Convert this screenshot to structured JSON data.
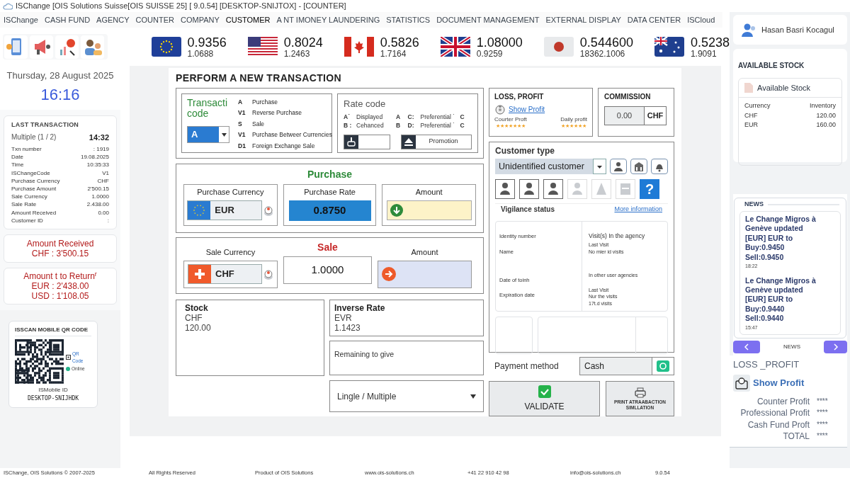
{
  "window": {
    "title": "ISChange [OIS Solutions Suisse[OIS SUISSE 25] [ 9.0.54] [DESKTOP-SNIJTOX] - [COUNTER]"
  },
  "menu": [
    {
      "label": "ISChange",
      "selected": false
    },
    {
      "label": "CASH FUND",
      "selected": false
    },
    {
      "label": "AGENCY",
      "selected": false
    },
    {
      "label": "COUNTER",
      "selected": false
    },
    {
      "label": "COMPANY",
      "selected": false
    },
    {
      "label": "CUSTOMER",
      "selected": true
    },
    {
      "label": "A NT IMONEY LAUNDERING",
      "selected": false
    },
    {
      "label": "STATISTICS",
      "selected": false
    },
    {
      "label": "DOCUMENT MANAGEMENT",
      "selected": false
    },
    {
      "label": "EXTERNAL DISPLAY",
      "selected": false
    },
    {
      "label": "DATA CENTER",
      "selected": false
    },
    {
      "label": "ISCloud",
      "selected": false
    }
  ],
  "rates": [
    {
      "kind": "eu",
      "rate": "0.9356",
      "inverse": "1.0688"
    },
    {
      "kind": "us",
      "rate": "0.8024",
      "inverse": "1.2463"
    },
    {
      "kind": "ca",
      "rate": "0.5826",
      "inverse": "1.7164"
    },
    {
      "kind": "gb",
      "rate": "1.08000",
      "inverse": "0.9259"
    },
    {
      "kind": "jp",
      "rate": "0.544600",
      "inverse": "18362.1006"
    },
    {
      "kind": "au",
      "rate": "0.5238",
      "inverse": "1.9091"
    }
  ],
  "clock": {
    "date": "Thursday, 28 August 2025",
    "time": "16:16"
  },
  "last_transaction": {
    "title": "LAST TRANSACTION",
    "mode": "Multiple (1 / 2)",
    "time": "14:32",
    "fields": [
      {
        "label": "Txn number",
        "value": ": 1919"
      },
      {
        "label": "Date",
        "value": "19.08.2025"
      },
      {
        "label": "Time",
        "value": "10:35:33"
      },
      {
        "label": "ISChangeCode",
        "value": "V1"
      },
      {
        "label": "Purchase Currency",
        "value": "CHF"
      },
      {
        "label": "Purchase Amount",
        "value": "2'500.15"
      },
      {
        "label": "Sale Currency",
        "value": "1.0000"
      },
      {
        "label": "Sale Rate",
        "value": "2.438.00"
      },
      {
        "label": "Amount Received",
        "value": "0.00"
      },
      {
        "label": "Customer ID",
        "value": ":"
      }
    ]
  },
  "amount_received": [
    "Amount Received",
    "CHF : 3'500.15"
  ],
  "amount_to_return": [
    "Amount t to Return$^{r}$",
    "EUR : 2'438.00",
    "USD : 1'108.05"
  ],
  "qr": {
    "title": "ISSCAN MOBILE QR CODE",
    "link": "QR Code",
    "status": "Online",
    "id_label": "ISMobile ID",
    "id": "DESKTOP-SNIJHDK"
  },
  "transaction": {
    "title": "PERFORM A NEW TRANSACTION",
    "code_label": "Transacti\ncode",
    "code_value": "A",
    "codes": [
      {
        "code": "A",
        "label": "Purchase"
      },
      {
        "code": "V1",
        "label": "Reverse Purchase"
      },
      {
        "code": "S",
        "label": "Sale"
      },
      {
        "code": "V1",
        "label": "Purchase Betweer Currencies"
      },
      {
        "code": "D1",
        "label": "Foreign Exchange Sale"
      }
    ],
    "rate_code": {
      "title": "Rate code",
      "items": [
        {
          "key": "A˙",
          "label": "Displayed",
          "code": "A"
        },
        {
          "key": "C:",
          "label": "Preferential ˙",
          "code": "C"
        },
        {
          "key": "B :",
          "label": "Cehanced",
          "code": "B"
        },
        {
          "key": "D:",
          "label": "Preferential ˙",
          "code": "C"
        }
      ],
      "promotion": "Promotion"
    }
  },
  "purchase": {
    "title": "Purchase",
    "currency_label": "Purchase Currency",
    "currency": "EUR",
    "rate_label": "Purchase Rate",
    "rate": "0.8750",
    "amount_label": "Amount"
  },
  "sale": {
    "title": "Sale",
    "currency_label": "Sale Currency",
    "currency": "CHF",
    "rate": "1.0000",
    "amount_label": "Amount"
  },
  "stock": {
    "title": "Stock",
    "currency": "CHF",
    "amount": "120.00"
  },
  "inverse_rate": {
    "title": "Inverse Rate",
    "currency": "EVR",
    "value": "1.1423"
  },
  "remaining": {
    "label": "Remaining to give"
  },
  "mode_select": {
    "value": "Lingle / Multiple"
  },
  "loss_profit": {
    "title": "LOSS, PROFIT",
    "link": "Show Profit",
    "items": [
      {
        "label": "Courter Proft",
        "value": "★★★★★★★"
      },
      {
        "label": "Daily profit",
        "value": "★★★★★★"
      }
    ]
  },
  "commission": {
    "title": "COMMISSION",
    "value": "0.00",
    "currency": "CHF"
  },
  "customer": {
    "title": "Customer type",
    "value": "Unidentified customer",
    "quick": [
      {
        "kind": "person"
      },
      {
        "kind": "building"
      },
      {
        "kind": "bell"
      }
    ],
    "types": [
      {
        "kind": "person",
        "disabled": false,
        "selected": false
      },
      {
        "kind": "person",
        "disabled": false,
        "selected": false
      },
      {
        "kind": "person",
        "disabled": false,
        "selected": false
      },
      {
        "kind": "person",
        "disabled": true,
        "selected": false
      },
      {
        "kind": "cone",
        "disabled": true,
        "selected": false
      },
      {
        "kind": "card",
        "disabled": true,
        "selected": false
      },
      {
        "kind": "help",
        "label": "?",
        "disabled": false,
        "selected": true
      }
    ]
  },
  "vigilance": {
    "title": "Vigilance status",
    "link": "More information",
    "rows": [
      {
        "label": "Identity number",
        "info": [
          "Visit(s) In the agency"
        ]
      },
      {
        "label": "Name",
        "info": [
          "Last Visit",
          "No mier id visits"
        ]
      },
      {
        "label": "Date of toinh",
        "info": [
          "In other user agencies"
        ]
      },
      {
        "label": "Expiration date",
        "info": [
          "Last Visit",
          "Nur the visits",
          "17t.d visits"
        ]
      }
    ]
  },
  "payment": {
    "label": "Payment method",
    "value": "Cash"
  },
  "actions": {
    "validate": "VALIDATE",
    "print": "PRINT ATRAABACTION\nSIMLLATION"
  },
  "user": {
    "name": "Hasan Basri Kocagul"
  },
  "available_stock": {
    "title": "AVAILABLE STOCK",
    "card_title": "Available Stock",
    "columns": [
      "Currency",
      "Inventory"
    ],
    "rows": [
      [
        "CHF",
        "120.00"
      ],
      [
        "EUR",
        "160.00"
      ]
    ]
  },
  "news": {
    "title": "NEWS",
    "items": [
      {
        "text": "Le Change Migros à\nGenève updated\n[EUR] EUR to\nBuy:0.9450\nSell:0.9450",
        "time": "18:22"
      },
      {
        "text": "Le Change Migros à\nGenève updated\n[EUR] EUR to\nBuy:0.9440\nSell:0.9440",
        "time": "15:47"
      }
    ],
    "footer": "NEWS"
  },
  "profit_panel": {
    "title": "LOSS _PROFIT",
    "link": "Show Profit",
    "rows": [
      {
        "label": "Counter Profit",
        "value": "****"
      },
      {
        "label": "Professional Profit",
        "value": "****"
      },
      {
        "label": "Cash Fund Proft",
        "value": "****"
      },
      {
        "label": "TOTAL",
        "value": "****"
      }
    ]
  },
  "footer": [
    "ISChange, OIS Solutions © 2007-2025",
    "All Rights Reserved",
    "Product of OIS Solutions",
    "www.ois-solutions.ch",
    "+41 22 910 42 98",
    "info@ois-solutions.ch",
    "9.0.54"
  ]
}
